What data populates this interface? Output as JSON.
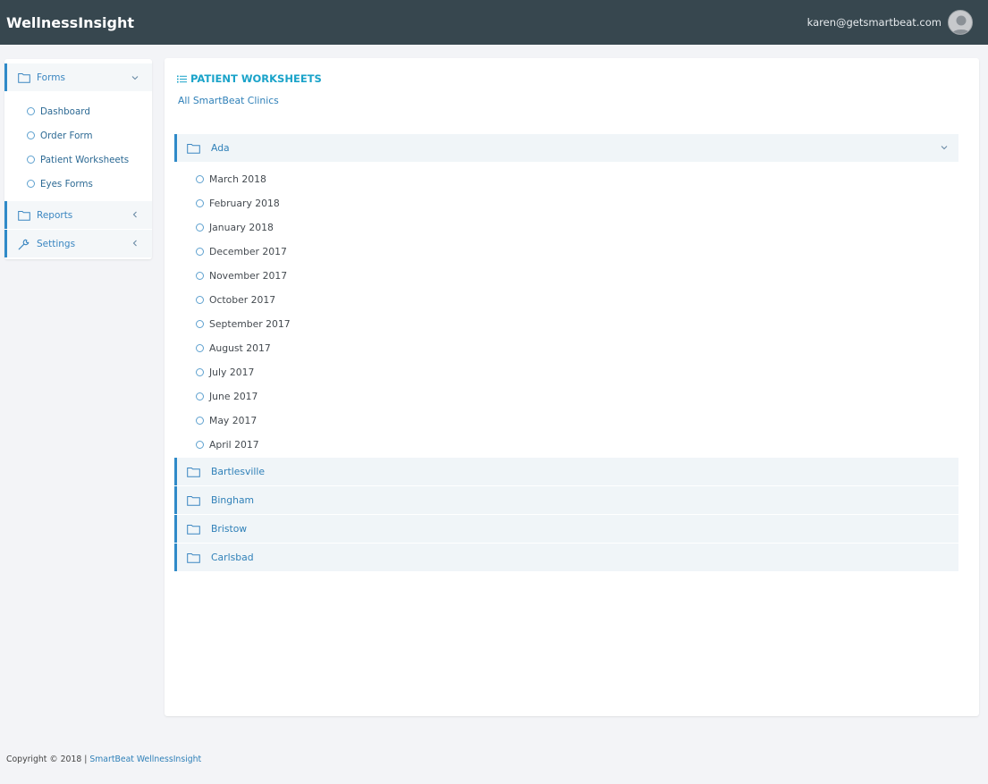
{
  "header": {
    "brand": "WellnessInsight",
    "user_email": "karen@getsmartbeat.com"
  },
  "sidebar": {
    "groups": [
      {
        "label": "Forms",
        "icon": "folder-icon",
        "expanded": true,
        "items": [
          {
            "label": "Dashboard"
          },
          {
            "label": "Order Form"
          },
          {
            "label": "Patient Worksheets"
          },
          {
            "label": "Eyes Forms"
          }
        ]
      },
      {
        "label": "Reports",
        "icon": "folder-icon",
        "expanded": false
      },
      {
        "label": "Settings",
        "icon": "wrench-icon",
        "expanded": false
      }
    ]
  },
  "main": {
    "title": "PATIENT WORKSHEETS",
    "all_clinics": "All SmartBeat Clinics",
    "clinics": [
      {
        "name": "Ada",
        "expanded": true,
        "months": [
          "March 2018",
          "February 2018",
          "January 2018",
          "December 2017",
          "November 2017",
          "October 2017",
          "September 2017",
          "August 2017",
          "July 2017",
          "June 2017",
          "May 2017",
          "April 2017"
        ]
      },
      {
        "name": "Bartlesville",
        "expanded": false
      },
      {
        "name": "Bingham",
        "expanded": false
      },
      {
        "name": "Bristow",
        "expanded": false
      },
      {
        "name": "Carlsbad",
        "expanded": false
      }
    ]
  },
  "footer": {
    "copyright": "Copyright © 2018 | ",
    "brand": "SmartBeat WellnessInsight"
  },
  "colors": {
    "topbar": "#37474f",
    "accent": "#2f8ac8",
    "title": "#1aa3c9",
    "link": "#2f80b8",
    "row_bg": "#f0f5f8",
    "page_bg": "#f3f4f7"
  }
}
